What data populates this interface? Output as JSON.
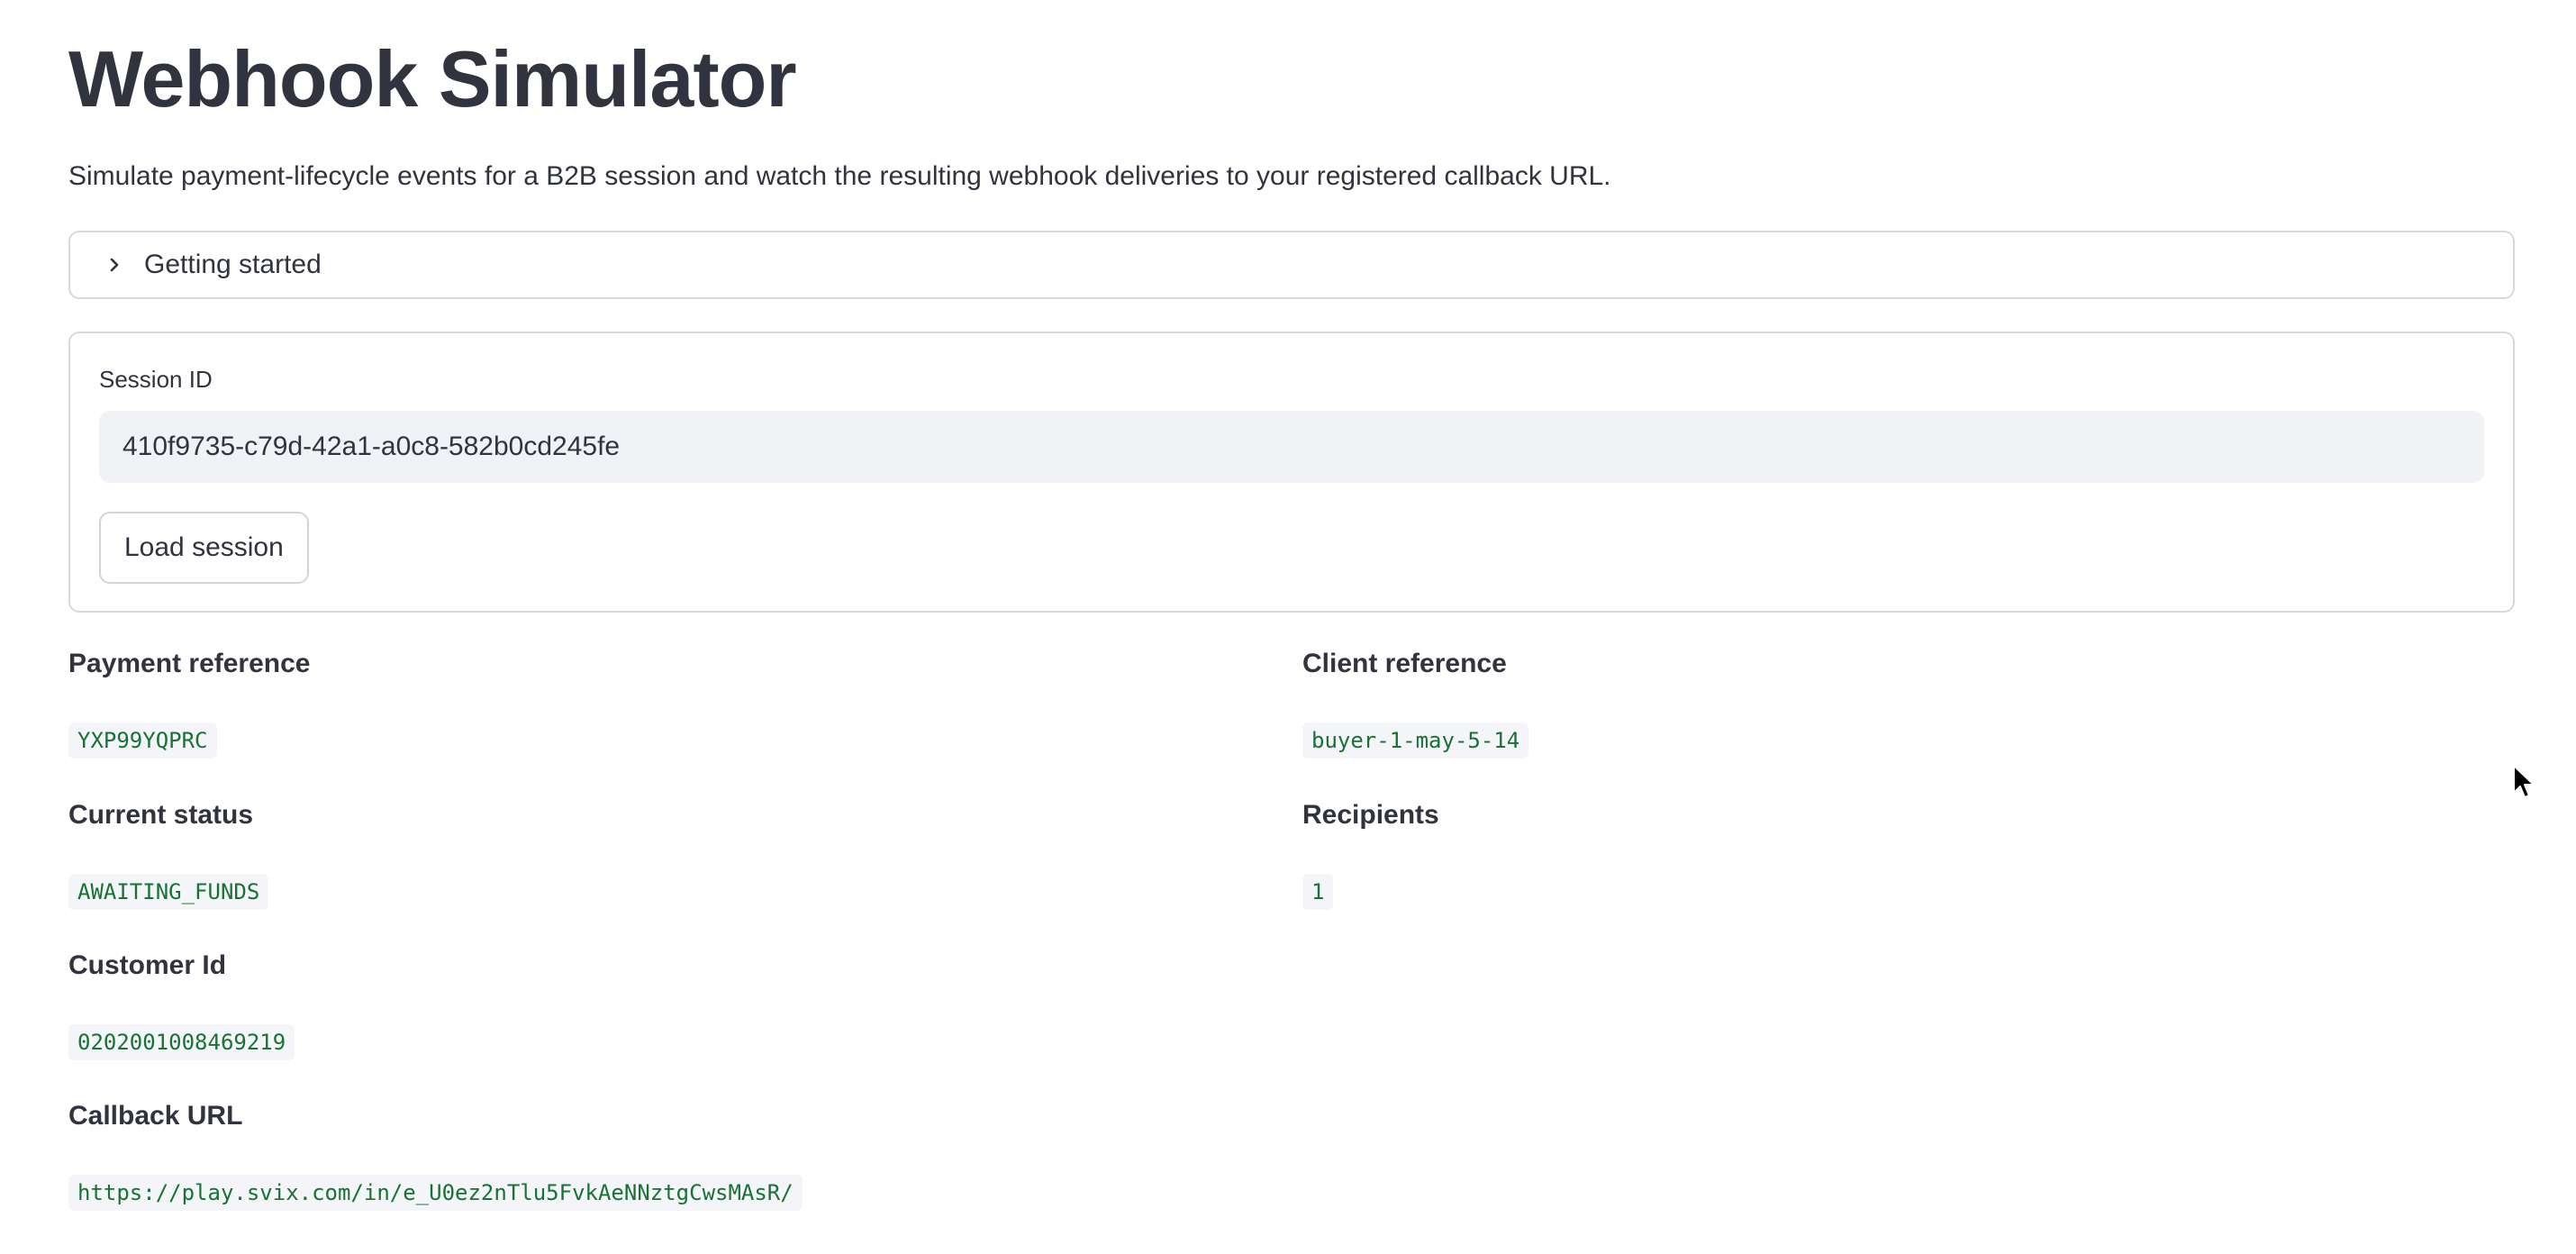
{
  "header": {
    "title": "Webhook Simulator",
    "subtitle": "Simulate payment-lifecycle events for a B2B session and watch the resulting webhook deliveries to your registered callback URL."
  },
  "expander": {
    "label": "Getting started",
    "icon": "chevron-right-icon"
  },
  "session_form": {
    "label": "Session ID",
    "value": "410f9735-c79d-42a1-a0c8-582b0cd245fe",
    "load_button": "Load session"
  },
  "details": {
    "payment_reference": {
      "label": "Payment reference",
      "value": "YXP99YQPRC"
    },
    "client_reference": {
      "label": "Client reference",
      "value": "buyer-1-may-5-14"
    },
    "current_status": {
      "label": "Current status",
      "value": "AWAITING_FUNDS"
    },
    "recipients": {
      "label": "Recipients",
      "value": "1"
    },
    "customer_id": {
      "label": "Customer Id",
      "value": "0202001008469219"
    },
    "callback_url": {
      "label": "Callback URL",
      "value": "https://play.svix.com/in/e_U0ez2nTlu5FvkAeNNztgCwsMAsR/"
    }
  },
  "colors": {
    "text": "#31333f",
    "code_text": "#177233",
    "code_bg": "#f4f5f8",
    "input_bg": "#f0f2f6",
    "border": "#d8d9de"
  }
}
